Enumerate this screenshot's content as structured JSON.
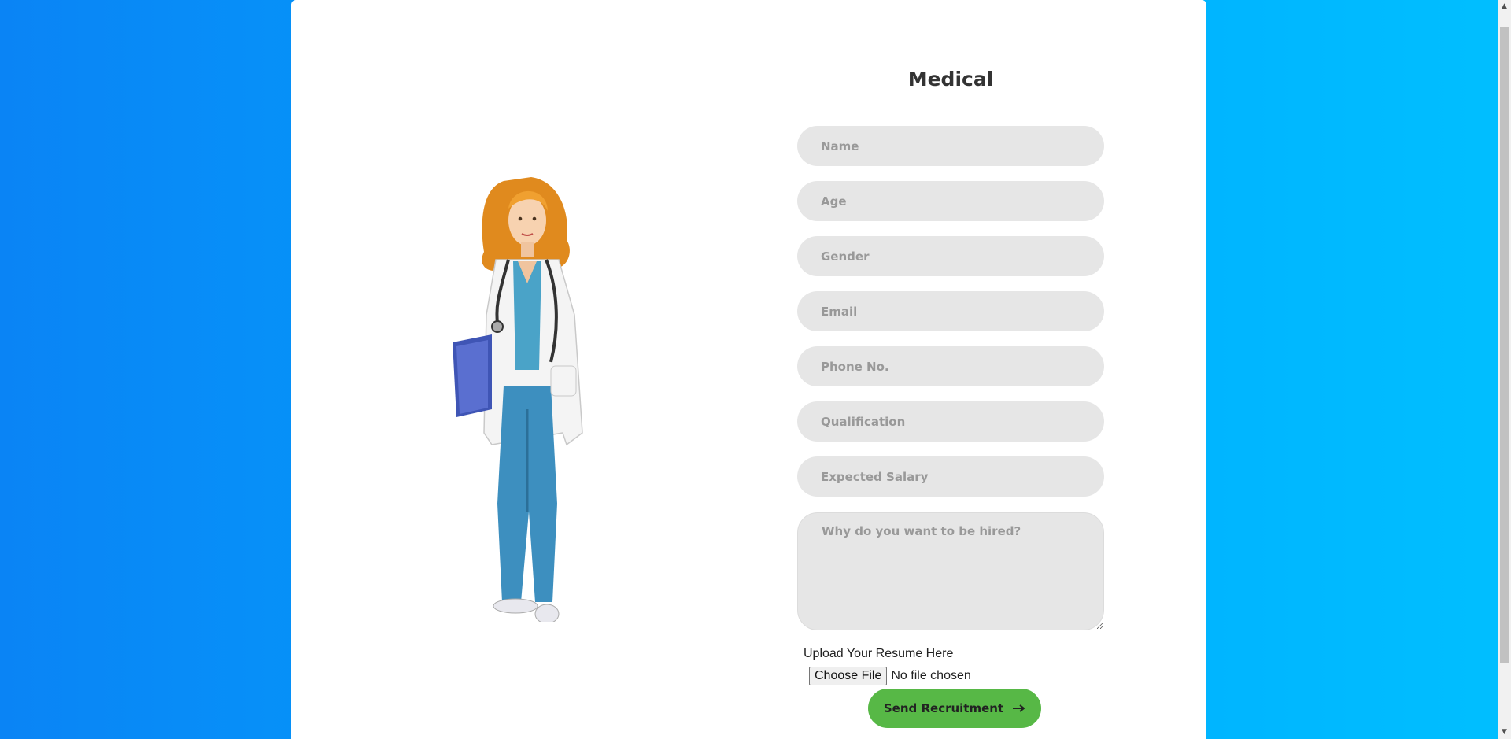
{
  "form": {
    "title": "Medical",
    "fields": {
      "name": "Name",
      "age": "Age",
      "gender": "Gender",
      "email": "Email",
      "phone": "Phone No.",
      "qualification": "Qualification",
      "salary": "Expected Salary",
      "reason": "Why do you want to be hired?"
    },
    "upload_label": "Upload Your Resume Here",
    "file_button": "Choose File",
    "file_status": "No file chosen",
    "submit_label": "Send Recruitment",
    "submit_icon": "arrow-right-icon"
  },
  "illustration": "doctor-illustration",
  "colors": {
    "background_left": "#0a84f5",
    "background_right": "#00bfff",
    "field_bg": "#e6e6e6",
    "placeholder": "#999999",
    "submit_bg": "#57b846"
  }
}
